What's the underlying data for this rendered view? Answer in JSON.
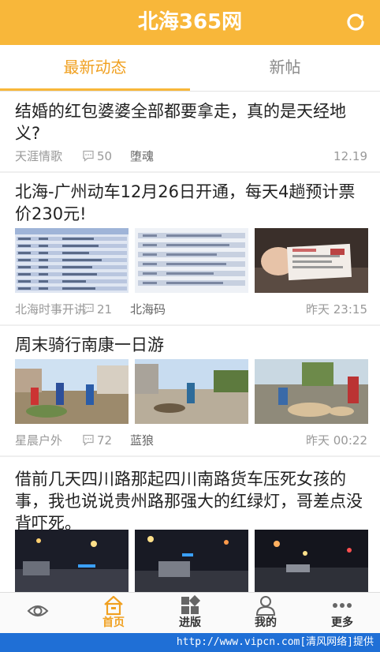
{
  "header": {
    "title": "北海365网"
  },
  "tabs": [
    {
      "label": "最新动态"
    },
    {
      "label": "新帖"
    }
  ],
  "posts": [
    {
      "title": "结婚的红包婆婆全部都要拿走，真的是天经地义?",
      "author": "天涯情歌",
      "comments": "50",
      "source": "堕魂",
      "time": "12.19"
    },
    {
      "title": "北海-广州动车12月26日开通，每天4趟预计票价230元!",
      "author": "北海时事开讲",
      "comments": "21",
      "source": "北海码",
      "time": "昨天 23:15"
    },
    {
      "title": "周末骑行南康一日游",
      "author": "星晨户外",
      "comments": "72",
      "source": "蓝狼",
      "time": "昨天 00:22"
    },
    {
      "title": "借前几天四川路那起四川南路货车压死女孩的事，我也说说贵州路那强大的红绿灯，哥差点没背吓死。"
    }
  ],
  "tabbar": [
    {
      "label": "",
      "icon": "eye-icon"
    },
    {
      "label": "首页",
      "icon": "home-icon"
    },
    {
      "label": "进版",
      "icon": "grid-icon"
    },
    {
      "label": "我的",
      "icon": "user-icon"
    },
    {
      "label": "更多",
      "icon": "more-icon"
    }
  ],
  "watermark": "http://www.vipcn.com[清风网络]提供",
  "colors": {
    "brand": "#f8b73a",
    "active": "#f0a020",
    "watermark": "#1f6fd6"
  }
}
